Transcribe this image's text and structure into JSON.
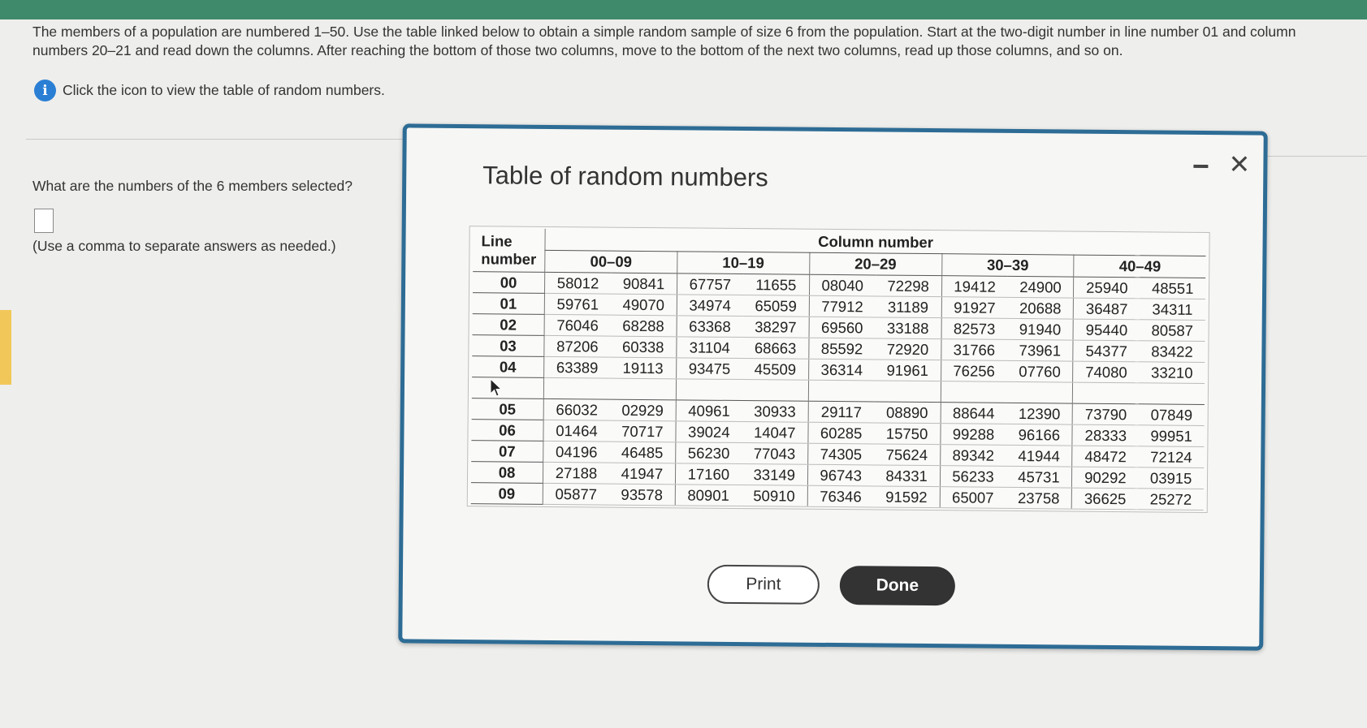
{
  "question": {
    "text": "The members of a population are numbered 1–50. Use the table linked below to obtain a simple random sample of size 6 from the population. Start at the two-digit number in line number 01 and column numbers 20–21 and read down the columns. After reaching the bottom of those two columns, move to the bottom of the next two columns, read up those columns, and so on.",
    "info_link": "Click the icon to view the table of random numbers.",
    "prompt": "What are the numbers of the 6 members selected?",
    "hint": "(Use a comma to separate answers as needed.)"
  },
  "dialog": {
    "title": "Table of random numbers",
    "print_label": "Print",
    "done_label": "Done",
    "close_glyph": "✕"
  },
  "table": {
    "line_header": "Line number",
    "column_header": "Column number",
    "groups": [
      "00–09",
      "10–19",
      "20–29",
      "30–39",
      "40–49"
    ],
    "rows": [
      {
        "line": "00",
        "values": [
          "58012",
          "90841",
          "67757",
          "11655",
          "08040",
          "72298",
          "19412",
          "24900",
          "25940",
          "48551"
        ]
      },
      {
        "line": "01",
        "values": [
          "59761",
          "49070",
          "34974",
          "65059",
          "77912",
          "31189",
          "91927",
          "20688",
          "36487",
          "34311"
        ]
      },
      {
        "line": "02",
        "values": [
          "76046",
          "68288",
          "63368",
          "38297",
          "69560",
          "33188",
          "82573",
          "91940",
          "95440",
          "80587"
        ]
      },
      {
        "line": "03",
        "values": [
          "87206",
          "60338",
          "31104",
          "68663",
          "85592",
          "72920",
          "31766",
          "73961",
          "54377",
          "83422"
        ]
      },
      {
        "line": "04",
        "values": [
          "63389",
          "19113",
          "93475",
          "45509",
          "36314",
          "91961",
          "76256",
          "07760",
          "74080",
          "33210"
        ]
      },
      {
        "line": "05",
        "values": [
          "66032",
          "02929",
          "40961",
          "30933",
          "29117",
          "08890",
          "88644",
          "12390",
          "73790",
          "07849"
        ]
      },
      {
        "line": "06",
        "values": [
          "01464",
          "70717",
          "39024",
          "14047",
          "60285",
          "15750",
          "99288",
          "96166",
          "28333",
          "99951"
        ]
      },
      {
        "line": "07",
        "values": [
          "04196",
          "46485",
          "56230",
          "77043",
          "74305",
          "75624",
          "89342",
          "41944",
          "48472",
          "72124"
        ]
      },
      {
        "line": "08",
        "values": [
          "27188",
          "41947",
          "17160",
          "33149",
          "96743",
          "84331",
          "56233",
          "45731",
          "90292",
          "03915"
        ]
      },
      {
        "line": "09",
        "values": [
          "05877",
          "93578",
          "80901",
          "50910",
          "76346",
          "91592",
          "65007",
          "23758",
          "36625",
          "25272"
        ]
      }
    ]
  }
}
